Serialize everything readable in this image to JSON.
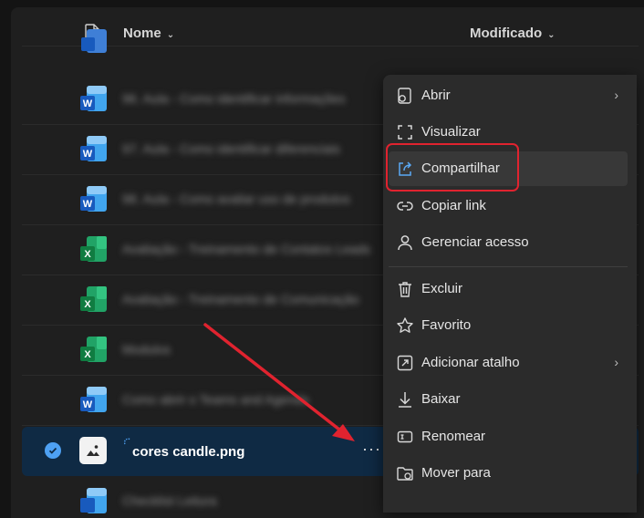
{
  "header": {
    "name_label": "Nome",
    "modified_label": "Modificado",
    "chevron": "⌄"
  },
  "files": [
    {
      "type": "word",
      "name": "96. Aula - Como identificar informações"
    },
    {
      "type": "word",
      "name": "97. Aula - Como identificar diferenciais"
    },
    {
      "type": "word",
      "name": "98. Aula - Como avaliar uso de produtos"
    },
    {
      "type": "excel",
      "name": "Avaliação - Treinamento de Contatos Leads"
    },
    {
      "type": "excel",
      "name": "Avaliação - Treinamento de Comunicação"
    },
    {
      "type": "excel",
      "name": "Modulos"
    },
    {
      "type": "word",
      "name": "Como abrir o Teams and Agenda"
    },
    {
      "type": "image",
      "name": "cores candle.png",
      "selected": true
    },
    {
      "type": "word",
      "name": "Checklist Leitura"
    }
  ],
  "menu": {
    "items": [
      {
        "label": "Abrir",
        "icon": "open-icon",
        "submenu": true
      },
      {
        "label": "Visualizar",
        "icon": "preview-icon"
      },
      {
        "label": "Compartilhar",
        "icon": "share-icon"
      },
      {
        "label": "Copiar link",
        "icon": "link-icon"
      },
      {
        "label": "Gerenciar acesso",
        "icon": "person-icon"
      },
      {
        "label": "Excluir",
        "icon": "trash-icon"
      },
      {
        "label": "Favorito",
        "icon": "star-icon"
      },
      {
        "label": "Adicionar atalho",
        "icon": "shortcut-icon",
        "submenu": true
      },
      {
        "label": "Baixar",
        "icon": "download-icon"
      },
      {
        "label": "Renomear",
        "icon": "rename-icon"
      },
      {
        "label": "Mover para",
        "icon": "move-icon"
      }
    ],
    "submenu_glyph": "›",
    "more_glyph": "···"
  },
  "colors": {
    "accent": "#4ea1f3",
    "annotation_red": "#e0232f",
    "selected_row": "#0f2a44"
  }
}
